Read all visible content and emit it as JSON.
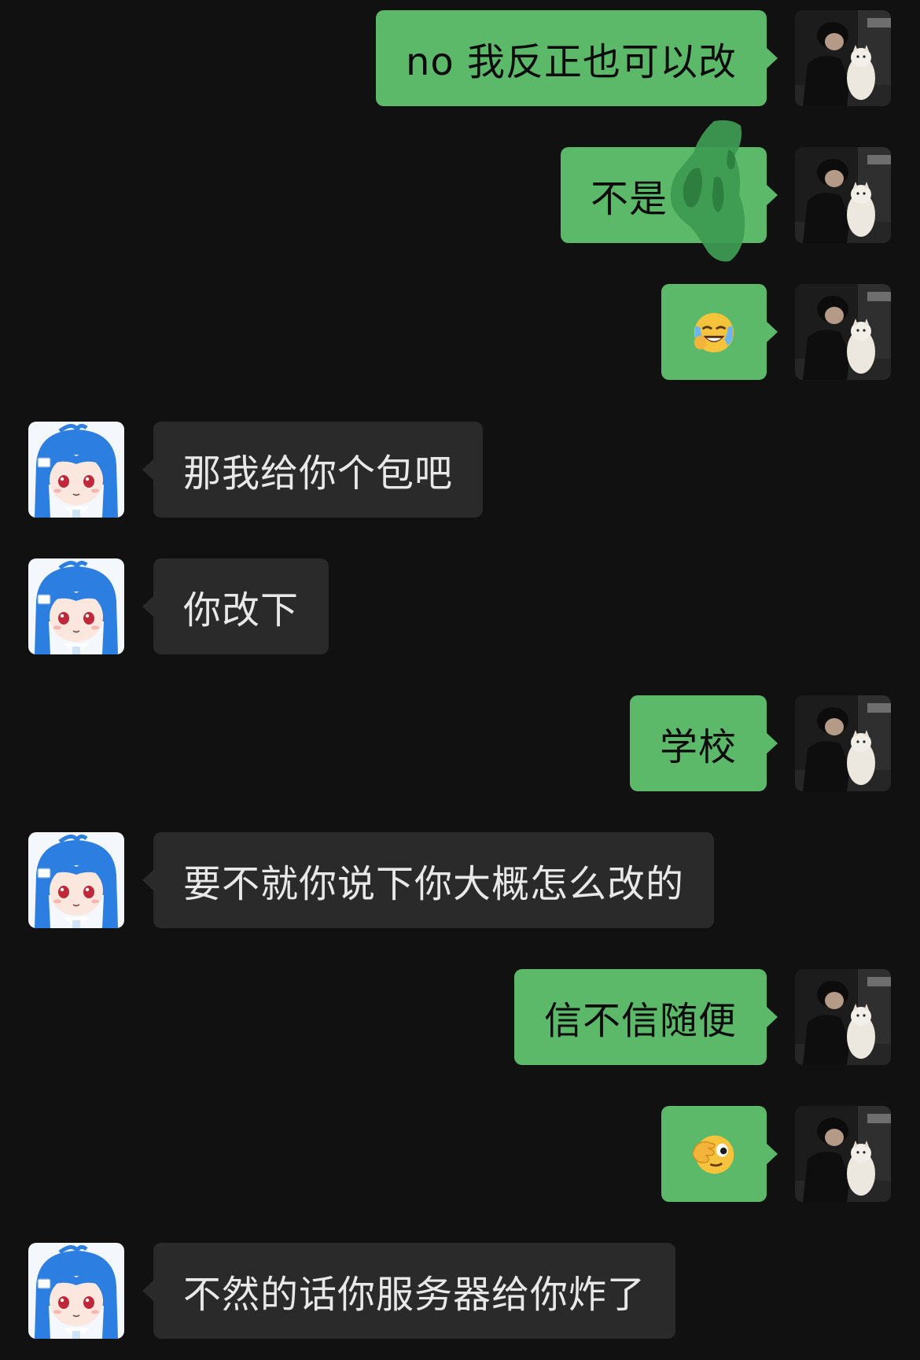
{
  "messages": [
    {
      "side": "out",
      "text": "no 我反正也可以改"
    },
    {
      "side": "out",
      "text": "不是",
      "redacted": true
    },
    {
      "side": "out",
      "emoji": "crying-laughing-face"
    },
    {
      "side": "in",
      "text": "那我给你个包吧"
    },
    {
      "side": "in",
      "text": "你改下"
    },
    {
      "side": "out",
      "text": "学校"
    },
    {
      "side": "in",
      "text": "要不就你说下你大概怎么改的"
    },
    {
      "side": "out",
      "text": "信不信随便"
    },
    {
      "side": "out",
      "emoji": "face-covering-eye"
    },
    {
      "side": "in",
      "text": "不然的话你服务器给你炸了"
    }
  ],
  "colors": {
    "background": "#111111",
    "outgoing_bubble": "#5cb96a",
    "incoming_bubble": "#2a2a2a",
    "redaction_scribble": "#3d9a52"
  },
  "avatars": {
    "self": "photo-person-with-dog-avatar",
    "other": "anime-blue-hair-girl-avatar"
  }
}
